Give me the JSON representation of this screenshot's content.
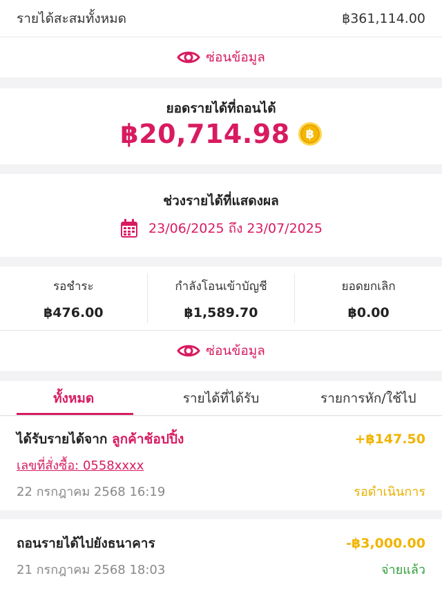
{
  "summary": {
    "total_label": "รายได้สะสมทั้งหมด",
    "total_value": "฿361,114.00"
  },
  "hide_toggle": {
    "label": "ซ่อนข้อมูล"
  },
  "available": {
    "label": "ยอดรายได้ที่ถอนได้",
    "amount": "฿20,714.98",
    "coin_symbol": "฿"
  },
  "period": {
    "label": "ช่วงรายได้ที่แสดงผล",
    "range": "23/06/2025 ถึง 23/07/2025"
  },
  "stats": [
    {
      "label": "รอชำระ",
      "value": "฿476.00"
    },
    {
      "label": "กำลังโอนเข้าบัญชี",
      "value": "฿1,589.70"
    },
    {
      "label": "ยอดยกเลิก",
      "value": "฿0.00"
    }
  ],
  "tabs": [
    "ทั้งหมด",
    "รายได้ที่ได้รับ",
    "รายการหัก/ใช้ไป"
  ],
  "transactions": [
    {
      "title_prefix": "ได้รับรายได้จาก",
      "source": "ลูกค้าช้อปปิ้ง",
      "amount": "+฿147.50",
      "order": "เลขที่สั่งซื้อ: 0558xxxx",
      "date": "22 กรกฎาคม 2568 16:19",
      "status": "รอดำเนินการ"
    },
    {
      "title_prefix": "ถอนรายได้ไปยังธนาคาร",
      "amount": "-฿3,000.00",
      "date": "21 กรกฎาคม 2568 18:03",
      "status": "จ่ายแล้ว"
    }
  ],
  "colors": {
    "accent": "#d81b60",
    "pending": "#e6b100",
    "paid": "#2e9e3a",
    "coin": "#f5b700"
  }
}
